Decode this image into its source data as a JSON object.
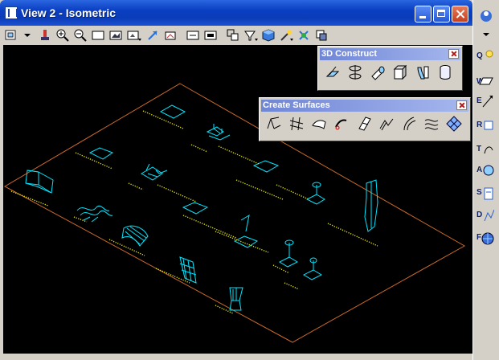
{
  "window": {
    "title": "View 2 - Isometric"
  },
  "palettes": {
    "construct": {
      "title": "3D Construct"
    },
    "surfaces": {
      "title": "Create Surfaces"
    }
  },
  "right_tools": [
    {
      "key": "Q",
      "icon": "q-tools-icon"
    },
    {
      "key": "W",
      "icon": "w-tools-icon"
    },
    {
      "key": "E",
      "icon": "e-tools-icon"
    },
    {
      "key": "R",
      "icon": "r-tools-icon"
    },
    {
      "key": "T",
      "icon": "t-tools-icon"
    },
    {
      "key": "A",
      "icon": "a-tools-icon"
    },
    {
      "key": "S",
      "icon": "s-tools-icon"
    },
    {
      "key": "D",
      "icon": "d-tools-icon"
    },
    {
      "key": "F",
      "icon": "f-tools-icon"
    }
  ],
  "colors": {
    "border": "#c96a2a",
    "geometry": "#00e6ff",
    "labels": "#e6e60a"
  }
}
